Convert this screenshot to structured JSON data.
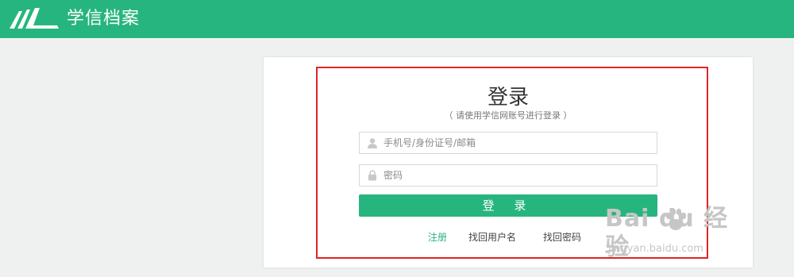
{
  "header": {
    "brand": "学信档案",
    "accent_color": "#27b57f",
    "logo_icon": "open-book-logo-icon"
  },
  "login": {
    "title": "登录",
    "hint": "（ 请使用学信网账号进行登录 ）",
    "username": {
      "placeholder": "手机号/身份证号/邮箱",
      "value": "",
      "icon": "user-icon"
    },
    "password": {
      "placeholder": "密码",
      "value": "",
      "icon": "lock-icon"
    },
    "submit_label": "登 录",
    "links": {
      "register": "注册",
      "recover_username": "找回用户名",
      "recover_password": "找回密码"
    },
    "highlight_color": "#e02424"
  },
  "watermark": {
    "main": "Bai  du 经验",
    "sub": "jingyan.baidu.com"
  }
}
